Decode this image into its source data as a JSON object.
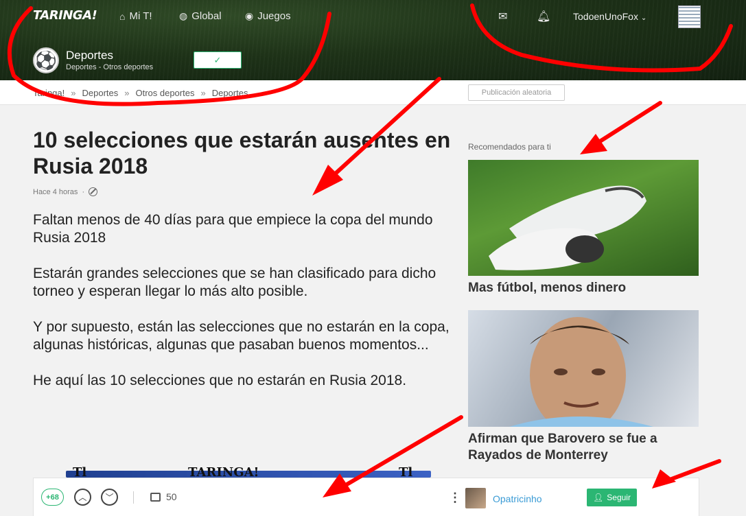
{
  "header": {
    "logo": "TARINGA!",
    "nav": [
      {
        "label": "Mi T!",
        "icon": "home-icon"
      },
      {
        "label": "Global",
        "icon": "globe-icon"
      },
      {
        "label": "Juegos",
        "icon": "gamepad-icon"
      }
    ],
    "username": "TodoenUnoFox",
    "category_title": "Deportes",
    "category_sub": "Deportes - Otros deportes",
    "follow_check": "✓"
  },
  "breadcrumb": [
    "Taringa!",
    "Deportes",
    "Otros deportes",
    "Deportes"
  ],
  "random_button": "Publicación aleatoria",
  "post": {
    "title": "10 selecciones que estarán ausentes en Rusia 2018",
    "time": "Hace 4 horas",
    "paragraphs": [
      "Faltan menos de 40 días para que empiece la copa del mundo Rusia 2018",
      "Estarán grandes selecciones que se han clasificado para dicho torneo y esperan llegar lo más alto posible.",
      "Y por supuesto, están las selecciones que no estarán en la copa, algunas históricas, algunas que pasaban buenos momentos...",
      "He aquí las 10 selecciones que no estarán en Rusia 2018."
    ]
  },
  "recommended": {
    "label": "Recomendados para ti",
    "items": [
      {
        "title": "Mas fútbol, menos dinero"
      },
      {
        "title": "Afirman que Barovero se fue a Rayados de Monterrey"
      }
    ]
  },
  "banner": {
    "left": "Tl",
    "center": "TARINGA!",
    "right": "Tl"
  },
  "bottombar": {
    "score": "+68",
    "comments": "50",
    "author": "Opatricinho",
    "follow": "Seguir"
  }
}
